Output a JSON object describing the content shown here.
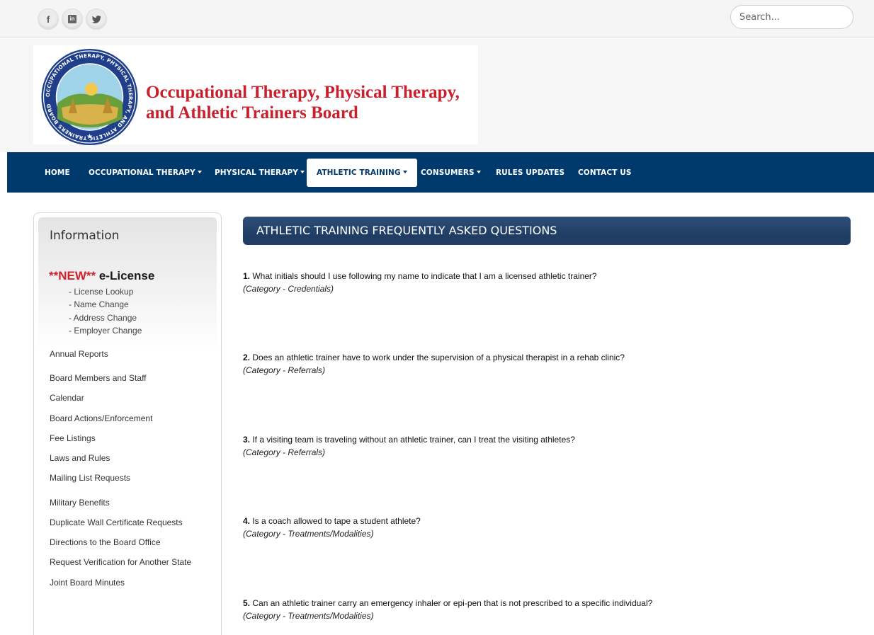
{
  "topbar": {
    "social": [
      {
        "icon": "facebook-icon",
        "glyph": "f"
      },
      {
        "icon": "linkedin-icon",
        "glyph": "in"
      },
      {
        "icon": "twitter-icon",
        "glyph": "✈"
      }
    ],
    "search_placeholder": "Search..."
  },
  "header": {
    "title": "Occupational Therapy, Physical Therapy, and Athletic Trainers Board",
    "seal_text": "OCCUPATIONAL THERAPY, PHYSICAL THERAPY, AND ATHLETIC TRAINERS BOARD"
  },
  "nav": {
    "items": [
      {
        "label": "HOME",
        "dropdown": false
      },
      {
        "label": "OCCUPATIONAL THERAPY",
        "dropdown": true
      },
      {
        "label": "PHYSICAL THERAPY",
        "dropdown": true
      },
      {
        "label": "ATHLETIC TRAINING",
        "dropdown": true,
        "active": true
      },
      {
        "label": "CONSUMERS",
        "dropdown": true
      },
      {
        "label": "RULES UPDATES",
        "dropdown": false
      },
      {
        "label": "CONTACT US",
        "dropdown": false
      }
    ]
  },
  "sidebar": {
    "title": "Information",
    "elicense_new": "**NEW**",
    "elicense_label": " e-License",
    "elicense_links": [
      "- License Lookup",
      "- Name Change",
      "- Address Change",
      "- Employer Change"
    ],
    "links": [
      "Annual Reports",
      "Board Members and Staff",
      "Calendar",
      "Board Actions/Enforcement",
      "Fee Listings",
      "Laws and Rules",
      "Mailing List Requests",
      "Military Benefits",
      "Duplicate Wall Certificate Requests",
      "Directions to the Board Office",
      "Request Verification for Another State",
      "Joint Board Minutes"
    ]
  },
  "main": {
    "heading": "ATHLETIC TRAINING FREQUENTLY ASKED QUESTIONS",
    "faqs": [
      {
        "num": "1.",
        "question": " What initials should I use following my name to indicate that I am a licensed athletic trainer?",
        "category": "(Category - Credentials)"
      },
      {
        "num": "2.",
        "question": " Does an athletic trainer have to work under the supervision of a physical therapist in a rehab clinic?",
        "category": "(Category - Referrals)"
      },
      {
        "num": "3.",
        "question": " If a visiting team is traveling without an athletic trainer, can I treat the visiting athletes?",
        "category": "(Category - Referrals)"
      },
      {
        "num": "4.",
        "question": " Is a coach allowed to tape a student athlete?",
        "category": "(Category - Treatments/Modalities)"
      },
      {
        "num": "5.",
        "question": " Can an athletic trainer carry an emergency inhaler or epi-pen that is not prescribed to a specific individual?",
        "category": "(Category - Treatments/Modalities)"
      }
    ]
  },
  "colors": {
    "nav_bg": "#003a6c",
    "title_red": "#c8202d",
    "new_red": "#d21f2a",
    "faq_header": "#1f3c63"
  }
}
